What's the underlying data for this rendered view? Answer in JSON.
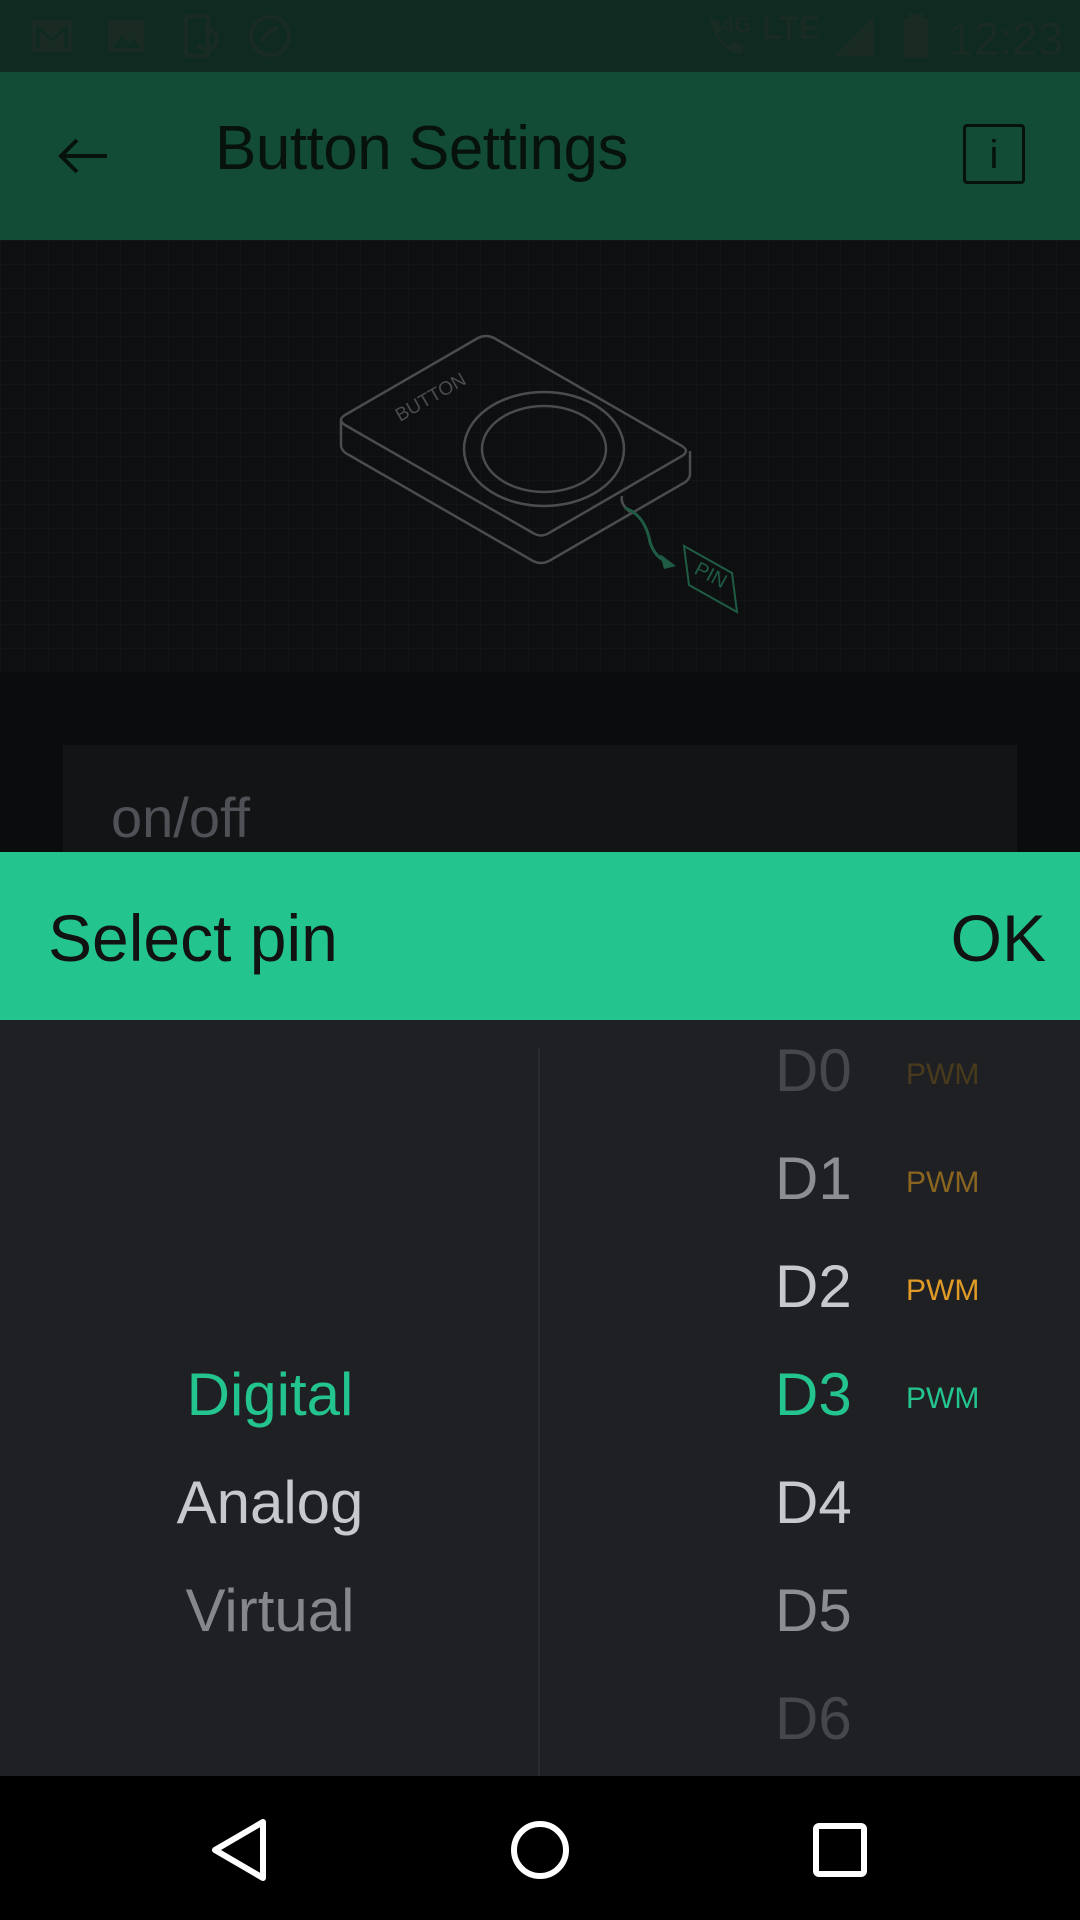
{
  "status_bar": {
    "time": "12:23",
    "network_small": "4G",
    "network": "LTE",
    "notification_icons": [
      "gmail-icon",
      "image-icon",
      "phone-sync-icon",
      "call-forward-icon"
    ],
    "system_icons": [
      "wifi-calling-icon",
      "signal-icon",
      "battery-icon"
    ]
  },
  "app_bar": {
    "title": "Button Settings",
    "back_icon": "arrow-left-icon",
    "info_icon": "info-icon",
    "info_label": "i"
  },
  "preview": {
    "device_label": "BUTTON",
    "pin_label": "PIN"
  },
  "name_field": {
    "value": "on/off"
  },
  "dialog": {
    "title": "Select pin",
    "ok_label": "OK",
    "pin_types": [
      {
        "label": "Digital",
        "color": "#23c48e"
      },
      {
        "label": "Analog",
        "color": "#c8c9cc"
      },
      {
        "label": "Virtual",
        "color": "#85878c"
      }
    ],
    "selected_type": "Digital",
    "pins": [
      {
        "label": "D0",
        "pwm": "PWM",
        "color": "#45474c",
        "pwm_color": "#4a3a1c"
      },
      {
        "label": "D1",
        "pwm": "PWM",
        "color": "#8c8e93",
        "pwm_color": "#8a6520"
      },
      {
        "label": "D2",
        "pwm": "PWM",
        "color": "#c8c9cc",
        "pwm_color": "#e09a26"
      },
      {
        "label": "D3",
        "pwm": "PWM",
        "color": "#23c48e",
        "pwm_color": "#23c48e"
      },
      {
        "label": "D4",
        "pwm": "",
        "color": "#c8c9cc",
        "pwm_color": ""
      },
      {
        "label": "D5",
        "pwm": "",
        "color": "#8c8e93",
        "pwm_color": ""
      },
      {
        "label": "D6",
        "pwm": "",
        "color": "#45474c",
        "pwm_color": ""
      }
    ],
    "selected_pin": "D3"
  },
  "nav_bar": {
    "back_icon": "nav-back-icon",
    "home_icon": "nav-home-icon",
    "recents_icon": "nav-recents-icon"
  },
  "colors": {
    "accent": "#23c48e",
    "app_bar": "#124c36",
    "status_bar": "#0f2a21",
    "dialog_background": "#1f2024"
  }
}
